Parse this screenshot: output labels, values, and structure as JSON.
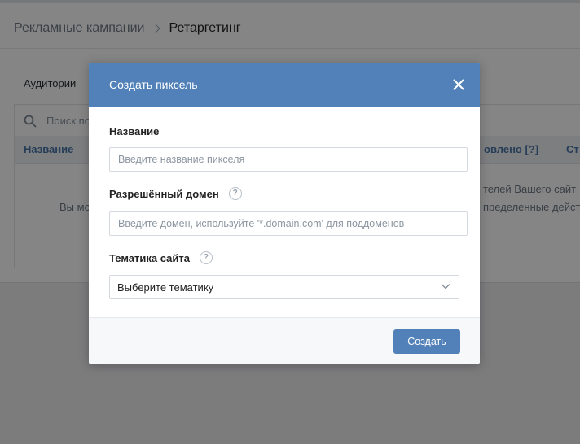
{
  "breadcrumb": {
    "parent": "Рекламные кампании",
    "current": "Ретаргетинг"
  },
  "tabs": {
    "audiences": "Аудитории"
  },
  "search": {
    "placeholder": "Поиск по"
  },
  "table": {
    "headers": [
      "Название",
      "овлено [?]",
      "Ст"
    ]
  },
  "empty_state": {
    "left_text": "Вы мо",
    "right_line1": "телей Вашего сайт",
    "right_line2": "пределенные дейст"
  },
  "modal": {
    "title": "Создать пиксель",
    "name_label": "Название",
    "name_placeholder": "Введите название пикселя",
    "domain_label": "Разрешённый домен",
    "domain_placeholder": "Введите домен, используйте '*.domain.com' для поддоменов",
    "topic_label": "Тематика сайта",
    "topic_selected": "Выберите тематику",
    "help_symbol": "?",
    "create_button": "Создать"
  },
  "colors": {
    "accent": "#5181b8",
    "link": "#4a76a8",
    "page_bg": "#edeef0"
  },
  "icons": {
    "close": "close-icon",
    "search": "search-icon",
    "breadcrumb_sep": "chevron-right-icon",
    "select": "chevron-down-icon",
    "help": "question-circle-icon"
  }
}
